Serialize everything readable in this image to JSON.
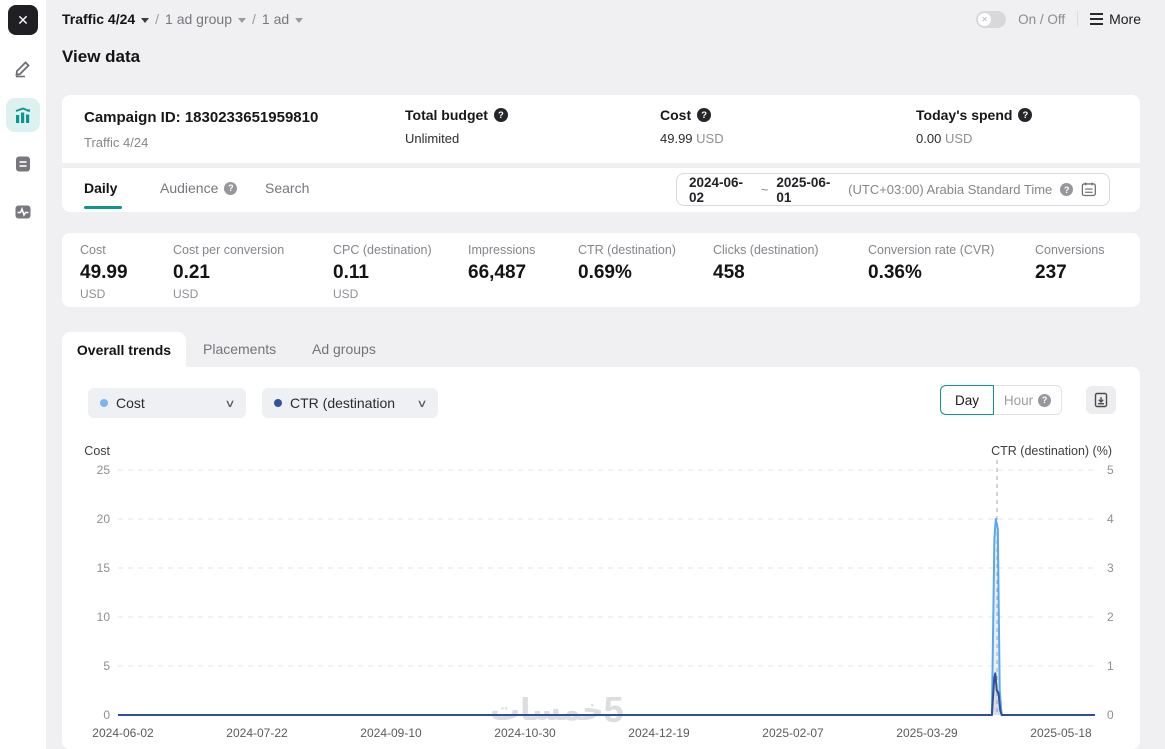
{
  "topbar": {
    "breadcrumb": {
      "campaign": "Traffic 4/24",
      "separator": "/",
      "ad_group": "1 ad group",
      "ad": "1 ad"
    },
    "toggle_label": "On / Off",
    "more_label": "More"
  },
  "page_title": "View data",
  "campaign_card": {
    "id_label": "Campaign ID: 1830233651959810",
    "name": "Traffic 4/24",
    "columns": [
      {
        "label": "Total budget",
        "value": "Unlimited",
        "unit": ""
      },
      {
        "label": "Cost",
        "value": "49.99",
        "unit": "USD"
      },
      {
        "label": "Today's spend",
        "value": "0.00",
        "unit": "USD"
      }
    ]
  },
  "view_tabs": [
    {
      "label": "Daily"
    },
    {
      "label": "Audience"
    },
    {
      "label": "Search"
    }
  ],
  "date_range": {
    "start": "2024-06-02",
    "tilde": "~",
    "end": "2025-06-01",
    "timezone": "(UTC+03:00) Arabia Standard Time"
  },
  "metrics": [
    {
      "label": "Cost",
      "value": "49.99",
      "unit": "USD"
    },
    {
      "label": "Cost per conversion",
      "value": "0.21",
      "unit": "USD"
    },
    {
      "label": "CPC (destination)",
      "value": "0.11",
      "unit": "USD"
    },
    {
      "label": "Impressions",
      "value": "66,487",
      "unit": ""
    },
    {
      "label": "CTR (destination)",
      "value": "0.69%",
      "unit": ""
    },
    {
      "label": "Clicks (destination)",
      "value": "458",
      "unit": ""
    },
    {
      "label": "Conversion rate (CVR)",
      "value": "0.36%",
      "unit": ""
    },
    {
      "label": "Conversions",
      "value": "237",
      "unit": ""
    }
  ],
  "trend_tabs": [
    {
      "label": "Overall trends"
    },
    {
      "label": "Placements"
    },
    {
      "label": "Ad groups"
    }
  ],
  "chart_controls": {
    "metric1": {
      "label": "Cost",
      "dot_color": "#7cb5ef"
    },
    "metric2": {
      "label": "CTR (destination",
      "dot_color": "#33539e"
    },
    "granularity": [
      {
        "label": "Day"
      },
      {
        "label": "Hour"
      }
    ]
  },
  "watermark": {
    "numeral": "5",
    "text": "خمسات"
  },
  "accent_color": "#0c968e",
  "chart_data": {
    "type": "line",
    "x_axis": {
      "tick_labels": [
        "2024-06-02",
        "2024-07-22",
        "2024-09-10",
        "2024-10-30",
        "2024-12-19",
        "2025-02-07",
        "2025-03-29",
        "2025-05-18"
      ]
    },
    "y_left": {
      "title": "Cost",
      "ticks": [
        0,
        5,
        10,
        15,
        20,
        25
      ],
      "range": [
        0,
        25
      ]
    },
    "y_right": {
      "title": "CTR (destination) (%)",
      "ticks": [
        0,
        1,
        2,
        3,
        4,
        5
      ],
      "range": [
        0,
        5
      ]
    },
    "grid": "dashed-horizontal",
    "annotation": {
      "vline_x_frac": 0.8997
    },
    "series": [
      {
        "name": "Cost",
        "axis": "left",
        "color": "#5aa7f0",
        "fill": "rgba(120,177,240,0.18)",
        "points": [
          [
            0,
            0
          ],
          [
            0.8945,
            0
          ],
          [
            0.897,
            18
          ],
          [
            0.8985,
            20
          ],
          [
            0.9005,
            19
          ],
          [
            0.9025,
            2.5
          ],
          [
            0.9045,
            0
          ],
          [
            1,
            0
          ]
        ]
      },
      {
        "name": "CTR (destination)",
        "axis": "right",
        "color": "#2f4f96",
        "fill": "rgba(100,100,110,0.14)",
        "points": [
          [
            0,
            0
          ],
          [
            0.8945,
            0
          ],
          [
            0.8968,
            0.75
          ],
          [
            0.898,
            0.85
          ],
          [
            0.8995,
            0.5
          ],
          [
            0.9012,
            0.45
          ],
          [
            0.903,
            0.1
          ],
          [
            0.9045,
            0
          ],
          [
            1,
            0
          ]
        ]
      }
    ]
  }
}
